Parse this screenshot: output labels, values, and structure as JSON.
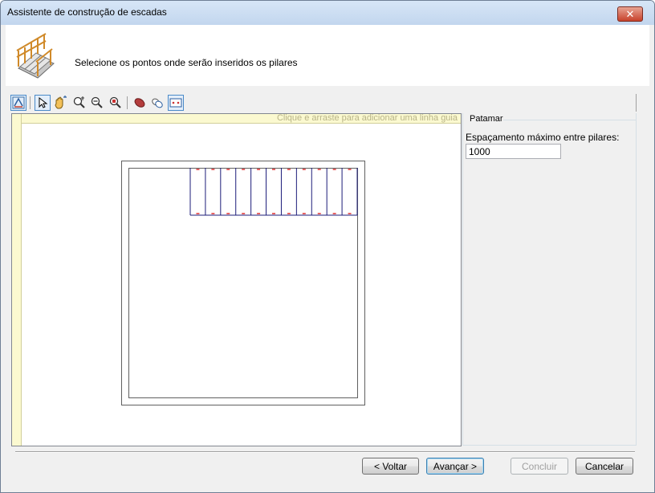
{
  "window": {
    "title": "Assistente de construção de escadas",
    "close_symbol": "✕"
  },
  "header": {
    "instruction": "Selecione os pontos onde serão inseridos os pilares",
    "icon": "stair-railing-icon"
  },
  "toolbar": {
    "tools": [
      {
        "name": "toggle-view-icon",
        "selected": true
      },
      {
        "name": "select-pointer-icon",
        "selected": true
      },
      {
        "name": "pan-hand-icon",
        "selected": false
      },
      {
        "name": "zoom-in-icon",
        "selected": false
      },
      {
        "name": "zoom-out-icon",
        "selected": false
      },
      {
        "name": "zoom-extents-icon",
        "selected": false
      },
      {
        "name": "delete-pillar-icon",
        "selected": false
      },
      {
        "name": "copy-pillar-icon",
        "selected": false
      },
      {
        "name": "pillar-spacing-icon",
        "selected": true
      }
    ]
  },
  "canvas": {
    "ruler_hint": "Clique e arraste para adicionar uma linha guia",
    "stair_steps": 11
  },
  "panel": {
    "group_title": "Patamar",
    "spacing_label": "Espaçamento máximo entre pilares:",
    "spacing_value": "1000"
  },
  "buttons": {
    "back": "< Voltar",
    "next": "Avançar >",
    "finish": "Concluir",
    "cancel": "Cancelar"
  },
  "colors": {
    "title_gradient_top": "#d7e6f7",
    "close_red": "#c7412b",
    "ruler_yellow": "#fbf9d0",
    "stair_lines": "#1c1c7a",
    "pillar_marks": "#e03030"
  }
}
